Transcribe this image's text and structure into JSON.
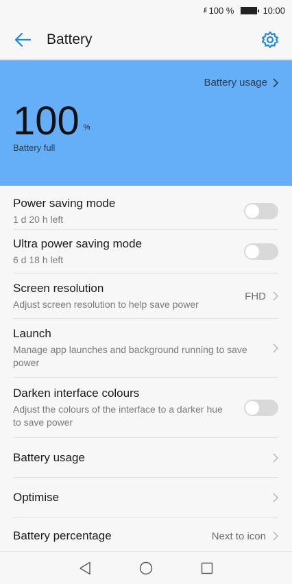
{
  "status_bar": {
    "signal": ".ıl",
    "battery": "100 %",
    "time": "10:00"
  },
  "app_bar": {
    "title": "Battery"
  },
  "hero": {
    "usage_link": "Battery usage",
    "percent": "100",
    "unit": "%",
    "status": "Battery full",
    "background": "#65aef8"
  },
  "items": [
    {
      "label": "Power saving mode",
      "sub": "1 d 20 h left",
      "control": "toggle",
      "on": false
    },
    {
      "label": "Ultra power saving mode",
      "sub": "6 d 18 h left",
      "control": "toggle",
      "on": false
    },
    {
      "label": "Screen resolution",
      "sub": "Adjust screen resolution to help save power",
      "value": "FHD",
      "control": "chevron"
    },
    {
      "label": "Launch",
      "sub": "Manage app launches and background running to save power",
      "control": "chevron"
    },
    {
      "label": "Darken interface colours",
      "sub": "Adjust the colours of the interface to a darker hue to save power",
      "control": "toggle",
      "on": false
    },
    {
      "label": "Battery usage",
      "control": "chevron"
    },
    {
      "label": "Optimise",
      "control": "chevron"
    },
    {
      "label": "Battery percentage",
      "value": "Next to icon",
      "control": "chevron"
    }
  ],
  "colors": {
    "accent": "#1e88e5",
    "hero": "#65aef8"
  },
  "nav": {
    "back": "back-triangle-icon",
    "home": "home-circle-icon",
    "recents": "recents-square-icon"
  }
}
